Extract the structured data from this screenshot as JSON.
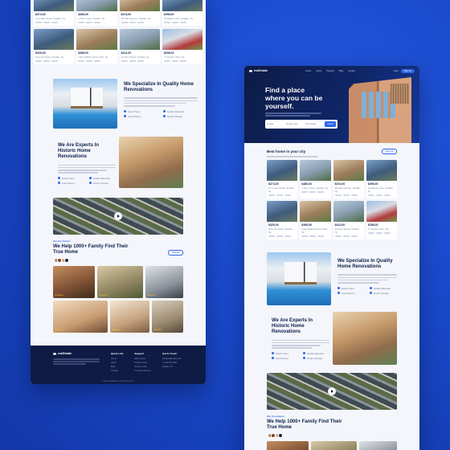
{
  "left": {
    "listing_rows": [
      [
        {
          "price": "$274,00",
          "addr": "2 Lumber Road, Seattle, Ny"
        },
        {
          "price": "$485,00",
          "addr": "1 Pine Court, Seattle, Ny"
        },
        {
          "price": "$374,00",
          "addr": "45 Oak Avenue, Seattle, Ny"
        },
        {
          "price": "$296,00",
          "addr": "12 Maple Lane, Seattle, Ny"
        }
      ],
      [
        {
          "price": "$325,00",
          "addr": "Second Street, Seattle, Ny"
        },
        {
          "price": "$398,00",
          "addr": "Lake William Drive Park, Ny"
        },
        {
          "price": "$412,00",
          "addr": "14 Pine Street, Seattle, Ny"
        },
        {
          "price": "$298,00",
          "addr": "77 Harbor View, Ny"
        }
      ]
    ],
    "specialize_title": "We Specialize In Quality Home Renovations",
    "experts_title": "We Are Experts In Historic Home Renovations",
    "features": [
      "Expert Team",
      "Quality Materials",
      "Fast Delivery",
      "Modern Design"
    ],
    "family_tag": "Our Customers",
    "family_title": "We Help 1000+ Family Find Their True Home",
    "view_all": "View All",
    "footer": {
      "logo": "realEstate",
      "cols": [
        {
          "title": "Quick Link",
          "items": [
            "Home",
            "About",
            "Blog",
            "Contact"
          ]
        },
        {
          "title": "Support",
          "items": [
            "Help Center",
            "Privacy Policy",
            "Terms of Use",
            "Customer Service"
          ]
        },
        {
          "title": "Get In Touch",
          "items": [
            "info@realestate.com",
            "+1 234 567 890",
            "Seattle, NY"
          ]
        }
      ],
      "copyright": "© 2023 realEstate. All rights reserved."
    }
  },
  "right": {
    "logo": "realEstate",
    "menu": [
      "Home",
      "About",
      "Property",
      "Blog",
      "Contact"
    ],
    "login": "Login",
    "signup": "Sign Up",
    "hero_title": "Find a place where you can be yourself.",
    "search_fields": [
      "Location",
      "Property Type",
      "Price Range"
    ],
    "search_button": "Search",
    "best_title": "Best home in your city",
    "view_all": "View All",
    "listing_rows": [
      [
        {
          "price": "$274,00",
          "addr": "2 Lumber Road, Seattle, Ny"
        },
        {
          "price": "$485,00",
          "addr": "1 Pine Court, Seattle, Ny"
        },
        {
          "price": "$374,00",
          "addr": "45 Oak Avenue, Seattle, Ny"
        },
        {
          "price": "$296,00",
          "addr": "12 Maple Lane, Seattle, Ny"
        }
      ],
      [
        {
          "price": "$325,00",
          "addr": "Second Street, Seattle, Ny"
        },
        {
          "price": "$398,00",
          "addr": "Lake William Drive Park, Ny"
        },
        {
          "price": "$412,00",
          "addr": "14 Pine Street, Seattle, Ny"
        },
        {
          "price": "$298,00",
          "addr": "77 Harbor View, Ny"
        }
      ]
    ],
    "specialize_title": "We Specialize In Quality Home Renovations",
    "experts_title": "We Are Experts In Historic Home Renovations",
    "features": [
      "Expert Team",
      "Quality Materials",
      "Fast Delivery",
      "Modern Design"
    ],
    "family_tag": "Our Customers",
    "family_title": "We Help 1000+ Family Find Their True Home"
  },
  "colors": {
    "background": "#1947c9",
    "accent": "#2f66e8",
    "navy": "#0e1f4a",
    "star": "#ffc738"
  }
}
